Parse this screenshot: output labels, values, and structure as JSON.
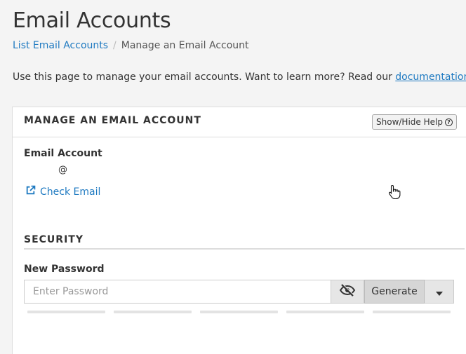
{
  "page": {
    "title": "Email Accounts"
  },
  "breadcrumb": {
    "items": [
      {
        "label": "List Email Accounts",
        "link": true
      },
      {
        "label": "Manage an Email Account",
        "link": false
      }
    ],
    "separator": "/"
  },
  "intro": {
    "text": "Use this page to manage your email accounts. Want to learn more? Read our ",
    "link_label": "documentation",
    "suffix": "."
  },
  "panel": {
    "title": "MANAGE AN EMAIL ACCOUNT",
    "help_button_label": "Show/Hide Help",
    "email_account_label": "Email Account",
    "email_value": "@",
    "check_email_label": "Check Email",
    "security_title": "SECURITY",
    "new_password_label": "New Password",
    "password_placeholder": "Enter Password",
    "generate_label": "Generate",
    "strength_segments": 5
  },
  "colors": {
    "link": "#1f7ac1",
    "background": "#f4f4f4",
    "panel": "#ffffff"
  },
  "icons": {
    "external_link": "external-link-icon",
    "help": "question-circle-icon",
    "visibility": "eye-slash-icon",
    "dropdown": "caret-down-icon"
  }
}
